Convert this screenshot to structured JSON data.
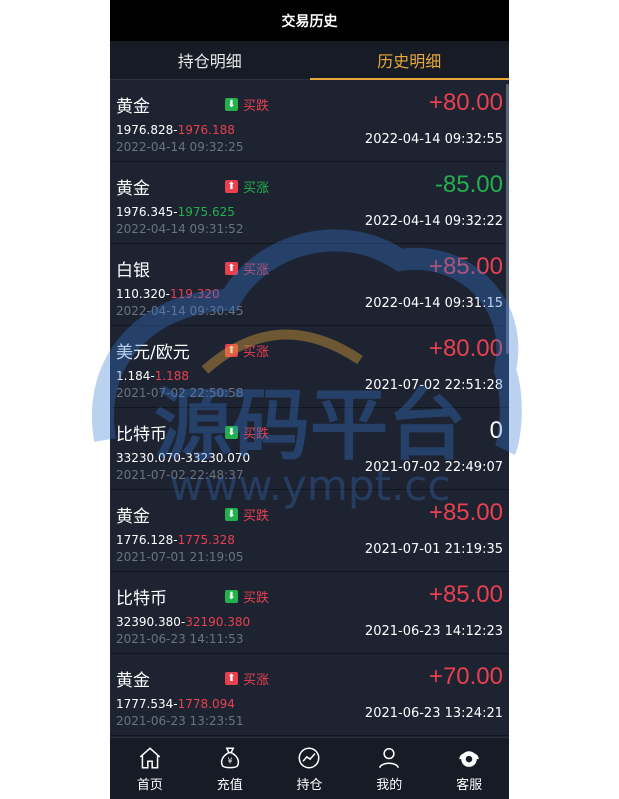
{
  "header": {
    "title": "交易历史"
  },
  "tabs": [
    {
      "label": "持仓明细",
      "active": false
    },
    {
      "label": "历史明细",
      "active": true
    }
  ],
  "records": [
    {
      "name": "黄金",
      "direction": "买跌",
      "direction_type": "down",
      "open_price": "1976.828",
      "close_price": "1976.188",
      "price_color": "red",
      "open_time": "2022-04-14 09:32:25",
      "profit": "+80.00",
      "profit_color": "red",
      "close_time": "2022-04-14 09:32:55"
    },
    {
      "name": "黄金",
      "direction": "买涨",
      "direction_type": "up",
      "open_price": "1976.345",
      "close_price": "1975.625",
      "price_color": "green",
      "open_time": "2022-04-14 09:31:52",
      "profit": "-85.00",
      "profit_color": "green",
      "close_time": "2022-04-14 09:32:22"
    },
    {
      "name": "白银",
      "direction": "买涨",
      "direction_type": "up",
      "open_price": "110.320",
      "close_price": "119.320",
      "price_color": "red",
      "open_time": "2022-04-14 09:30:45",
      "profit": "+85.00",
      "profit_color": "red",
      "close_time": "2022-04-14 09:31:15"
    },
    {
      "name": "美元/欧元",
      "direction": "买涨",
      "direction_type": "up",
      "open_price": "1.184",
      "close_price": "1.188",
      "price_color": "red",
      "open_time": "2021-07-02 22:50:58",
      "profit": "+80.00",
      "profit_color": "red",
      "close_time": "2021-07-02 22:51:28"
    },
    {
      "name": "比特币",
      "direction": "买跌",
      "direction_type": "down",
      "open_price": "33230.070",
      "close_price": "33230.070",
      "price_color": "white",
      "open_time": "2021-07-02 22:48:37",
      "profit": "0",
      "profit_color": "white",
      "close_time": "2021-07-02 22:49:07"
    },
    {
      "name": "黄金",
      "direction": "买跌",
      "direction_type": "down",
      "open_price": "1776.128",
      "close_price": "1775.328",
      "price_color": "red",
      "open_time": "2021-07-01 21:19:05",
      "profit": "+85.00",
      "profit_color": "red",
      "close_time": "2021-07-01 21:19:35"
    },
    {
      "name": "比特币",
      "direction": "买跌",
      "direction_type": "down",
      "open_price": "32390.380",
      "close_price": "32190.380",
      "price_color": "red",
      "open_time": "2021-06-23 14:11:53",
      "profit": "+85.00",
      "profit_color": "red",
      "close_time": "2021-06-23 14:12:23"
    },
    {
      "name": "黄金",
      "direction": "买涨",
      "direction_type": "up",
      "open_price": "1777.534",
      "close_price": "1778.094",
      "price_color": "red",
      "open_time": "2021-06-23 13:23:51",
      "profit": "+70.00",
      "profit_color": "red",
      "close_time": "2021-06-23 13:24:21"
    }
  ],
  "nav": [
    {
      "label": "首页",
      "icon": "home-icon"
    },
    {
      "label": "充值",
      "icon": "money-bag-icon"
    },
    {
      "label": "持仓",
      "icon": "chart-icon"
    },
    {
      "label": "我的",
      "icon": "user-icon"
    },
    {
      "label": "客服",
      "icon": "headset-icon"
    }
  ],
  "watermark": {
    "text": "源码平台",
    "url": "www.ympt.cc"
  },
  "colors": {
    "up": "#e8404f",
    "down": "#22b14c",
    "accent": "#e8a93a"
  }
}
